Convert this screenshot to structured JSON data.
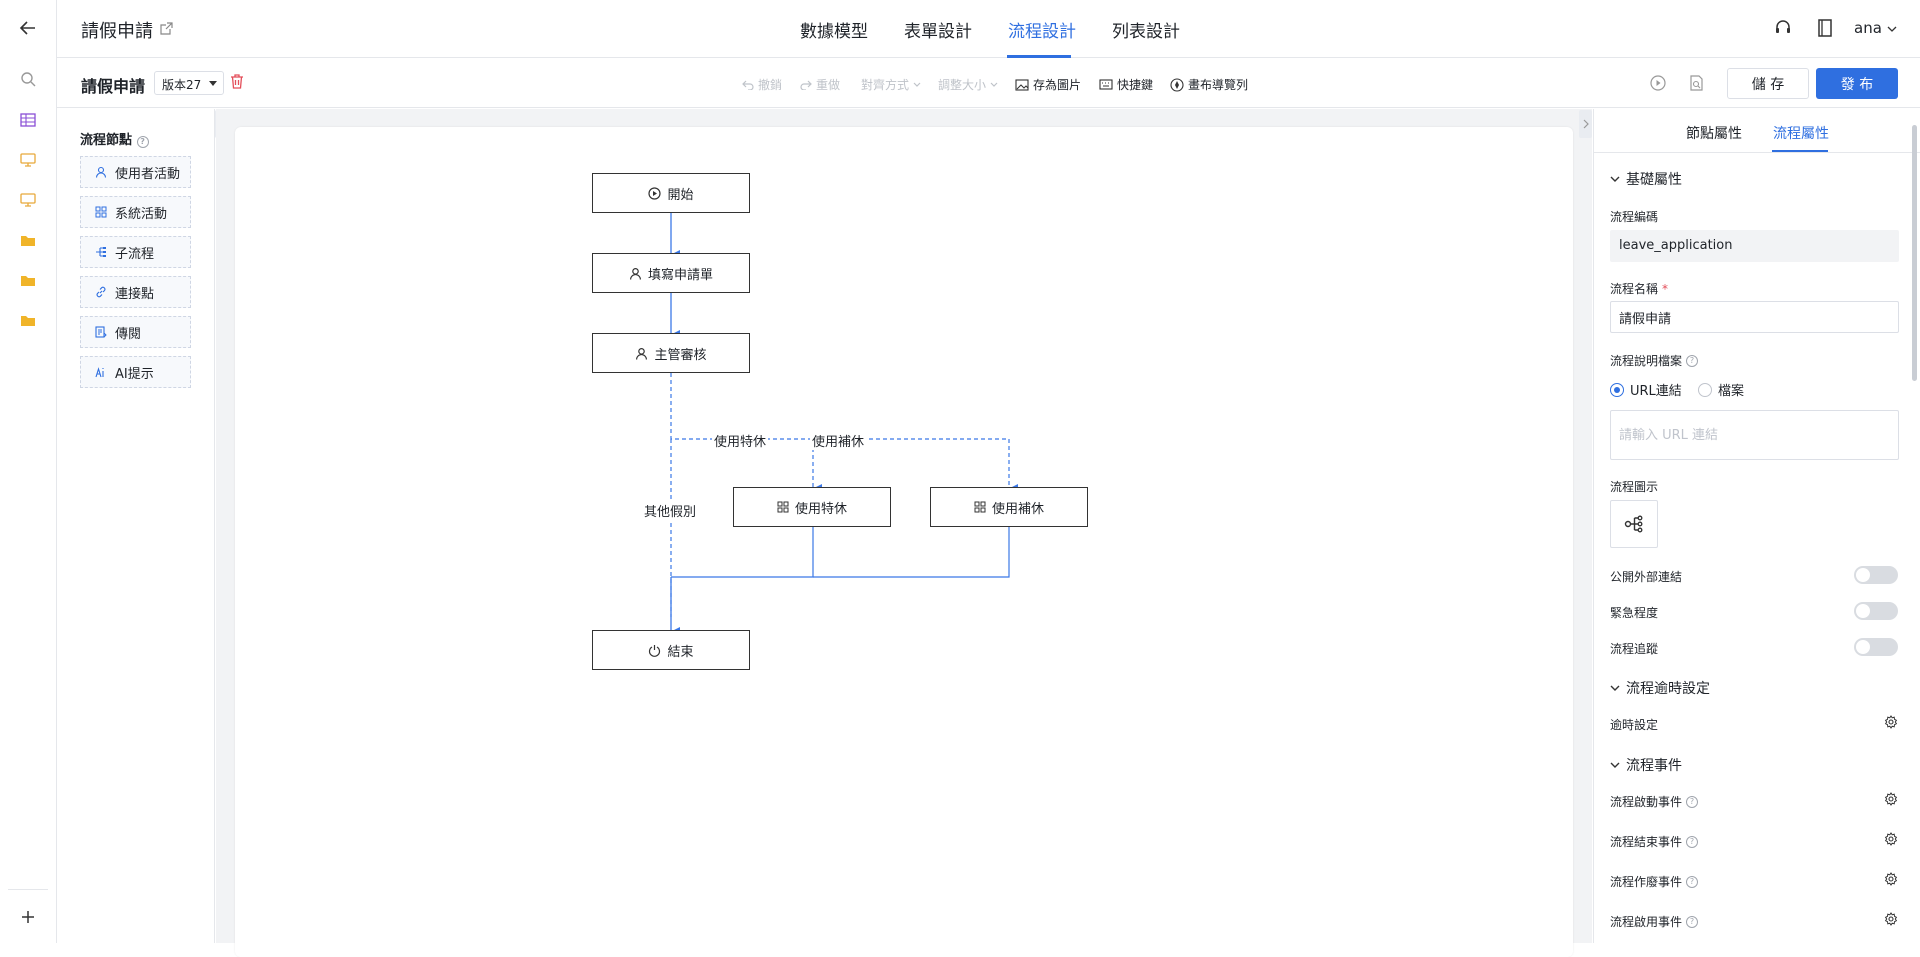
{
  "header": {
    "app_title": "請假申請",
    "tabs": [
      "數據模型",
      "表單設計",
      "流程設計",
      "列表設計"
    ],
    "active_tab": "流程設計",
    "user": "ana"
  },
  "toolbar": {
    "flow_title": "請假申請",
    "version": "版本27",
    "undo": "撤銷",
    "redo": "重做",
    "align": "對齊方式",
    "resize": "調整大小",
    "save_image": "存為圖片",
    "shortcuts": "快捷鍵",
    "layout_nav": "畫布導覽列",
    "save_label": "儲 存",
    "publish_label": "發 布"
  },
  "nodes_panel": {
    "title": "流程節點",
    "items": [
      "使用者活動",
      "系統活動",
      "子流程",
      "連接點",
      "傳閱",
      "AI提示"
    ]
  },
  "flow": {
    "start": "開始",
    "fill_form": "填寫申請單",
    "manager_review": "主管審核",
    "use_special_leave": "使用特休",
    "use_comp_leave": "使用補休",
    "end": "結束",
    "edge_special": "使用特休",
    "edge_comp": "使用補休",
    "edge_other": "其他假別"
  },
  "props": {
    "tabs": [
      "節點屬性",
      "流程屬性"
    ],
    "active_tab": "流程屬性",
    "section_basic": "基礎屬性",
    "code_label": "流程編碼",
    "code_value": "leave_application",
    "name_label": "流程名稱",
    "name_value": "請假申請",
    "doc_label": "流程說明檔案",
    "radio_url": "URL連結",
    "radio_file": "檔案",
    "url_placeholder": "請輸入 URL 連結",
    "icon_label": "流程圖示",
    "public_link": "公開外部連結",
    "urgency": "緊急程度",
    "tracking": "流程追蹤",
    "section_timeout": "流程逾時設定",
    "timeout": "逾時設定",
    "section_events": "流程事件",
    "event_start": "流程啟動事件",
    "event_end": "流程結束事件",
    "event_void": "流程作廢事件",
    "event_enable": "流程啟用事件"
  },
  "colors": {
    "accent": "#2f6fe0",
    "danger": "#e34d59"
  }
}
